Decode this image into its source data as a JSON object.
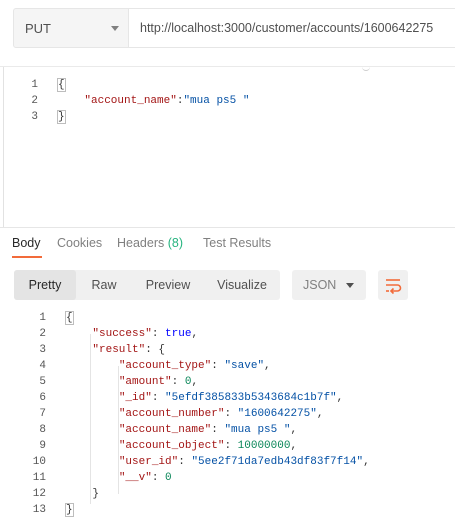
{
  "request": {
    "method": "PUT",
    "url": "http://localhost:3000/customer/accounts/1600642275"
  },
  "body_editor": {
    "line_numbers": [
      "1",
      "2",
      "3"
    ],
    "lines": [
      [
        {
          "t": "{",
          "c": "p"
        }
      ],
      [
        {
          "t": "    ",
          "c": "p"
        },
        {
          "t": "\"account_name\"",
          "c": "k"
        },
        {
          "t": ":",
          "c": "p"
        },
        {
          "t": "\"mua ps5 \"",
          "c": "s"
        }
      ],
      [
        {
          "t": "}",
          "c": "p"
        }
      ]
    ]
  },
  "response_tabs": {
    "body": "Body",
    "cookies": "Cookies",
    "headers": "Headers",
    "headers_count": "(8)",
    "test_results": "Test Results"
  },
  "view_toolbar": {
    "pretty": "Pretty",
    "raw": "Raw",
    "preview": "Preview",
    "visualize": "Visualize",
    "format": "JSON",
    "wrap_icon": "wrap-lines-icon",
    "accent": "#f26b3a"
  },
  "response_editor": {
    "line_numbers": [
      "1",
      "2",
      "3",
      "4",
      "5",
      "6",
      "7",
      "8",
      "9",
      "10",
      "11",
      "12",
      "13"
    ],
    "lines": [
      [
        {
          "t": "{",
          "c": "p"
        }
      ],
      [
        {
          "t": "    ",
          "c": "p"
        },
        {
          "t": "\"success\"",
          "c": "k"
        },
        {
          "t": ": ",
          "c": "p"
        },
        {
          "t": "true",
          "c": "b"
        },
        {
          "t": ",",
          "c": "p"
        }
      ],
      [
        {
          "t": "    ",
          "c": "p"
        },
        {
          "t": "\"result\"",
          "c": "k"
        },
        {
          "t": ": {",
          "c": "p"
        }
      ],
      [
        {
          "t": "        ",
          "c": "p"
        },
        {
          "t": "\"account_type\"",
          "c": "k"
        },
        {
          "t": ": ",
          "c": "p"
        },
        {
          "t": "\"save\"",
          "c": "s"
        },
        {
          "t": ",",
          "c": "p"
        }
      ],
      [
        {
          "t": "        ",
          "c": "p"
        },
        {
          "t": "\"amount\"",
          "c": "k"
        },
        {
          "t": ": ",
          "c": "p"
        },
        {
          "t": "0",
          "c": "n"
        },
        {
          "t": ",",
          "c": "p"
        }
      ],
      [
        {
          "t": "        ",
          "c": "p"
        },
        {
          "t": "\"_id\"",
          "c": "k"
        },
        {
          "t": ": ",
          "c": "p"
        },
        {
          "t": "\"5efdf385833b5343684c1b7f\"",
          "c": "s"
        },
        {
          "t": ",",
          "c": "p"
        }
      ],
      [
        {
          "t": "        ",
          "c": "p"
        },
        {
          "t": "\"account_number\"",
          "c": "k"
        },
        {
          "t": ": ",
          "c": "p"
        },
        {
          "t": "\"1600642275\"",
          "c": "s"
        },
        {
          "t": ",",
          "c": "p"
        }
      ],
      [
        {
          "t": "        ",
          "c": "p"
        },
        {
          "t": "\"account_name\"",
          "c": "k"
        },
        {
          "t": ": ",
          "c": "p"
        },
        {
          "t": "\"mua ps5 \"",
          "c": "s"
        },
        {
          "t": ",",
          "c": "p"
        }
      ],
      [
        {
          "t": "        ",
          "c": "p"
        },
        {
          "t": "\"account_object\"",
          "c": "k"
        },
        {
          "t": ": ",
          "c": "p"
        },
        {
          "t": "10000000",
          "c": "n"
        },
        {
          "t": ",",
          "c": "p"
        }
      ],
      [
        {
          "t": "        ",
          "c": "p"
        },
        {
          "t": "\"user_id\"",
          "c": "k"
        },
        {
          "t": ": ",
          "c": "p"
        },
        {
          "t": "\"5ee2f71da7edb43df83f7f14\"",
          "c": "s"
        },
        {
          "t": ",",
          "c": "p"
        }
      ],
      [
        {
          "t": "        ",
          "c": "p"
        },
        {
          "t": "\"__v\"",
          "c": "k"
        },
        {
          "t": ": ",
          "c": "p"
        },
        {
          "t": "0",
          "c": "n"
        }
      ],
      [
        {
          "t": "    }",
          "c": "p"
        }
      ],
      [
        {
          "t": "}",
          "c": "p"
        }
      ]
    ]
  }
}
